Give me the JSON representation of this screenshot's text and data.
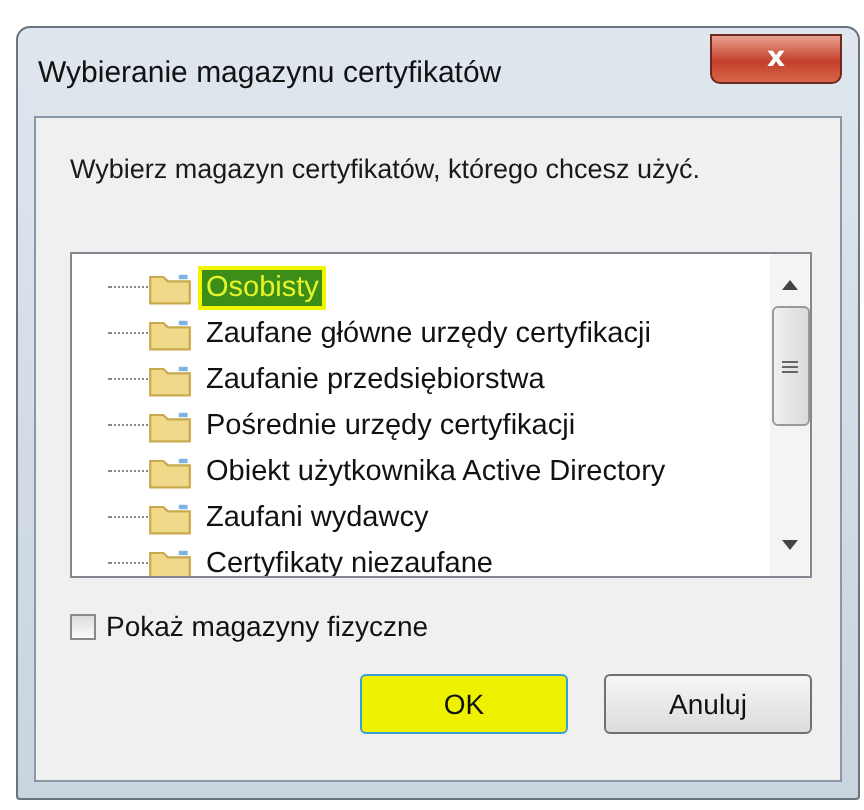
{
  "window": {
    "title": "Wybieranie magazynu certyfikatów",
    "close": "x"
  },
  "prompt": "Wybierz magazyn certyfikatów, którego chcesz użyć.",
  "stores": [
    {
      "label": "Osobisty",
      "selected": true
    },
    {
      "label": "Zaufane główne urzędy certyfikacji",
      "selected": false
    },
    {
      "label": "Zaufanie przedsiębiorstwa",
      "selected": false
    },
    {
      "label": "Pośrednie urzędy certyfikacji",
      "selected": false
    },
    {
      "label": "Obiekt użytkownika Active Directory",
      "selected": false
    },
    {
      "label": "Zaufani wydawcy",
      "selected": false
    },
    {
      "label": "Certyfikaty niezaufane",
      "selected": false
    }
  ],
  "show_physical": {
    "label": "Pokaż magazyny fizyczne",
    "checked": false
  },
  "buttons": [
    {
      "label": "OK",
      "highlighted": true
    },
    {
      "label": "Anuluj",
      "highlighted": false
    }
  ]
}
